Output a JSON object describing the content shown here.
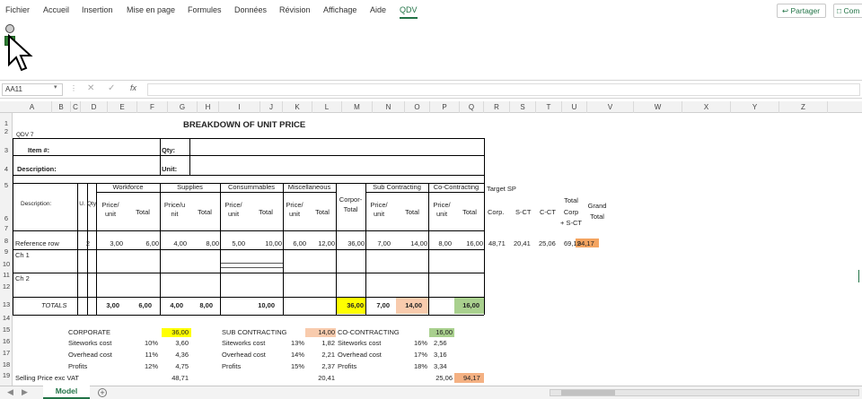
{
  "menu": [
    "Fichier",
    "Accueil",
    "Insertion",
    "Mise en page",
    "Formules",
    "Données",
    "Révision",
    "Affichage",
    "Aide",
    "QDV"
  ],
  "share_label": "Partager",
  "comments_label": "Com",
  "namebox": "AA11",
  "formula_value": "",
  "columns": [
    "A",
    "B",
    "C",
    "D",
    "E",
    "F",
    "G",
    "H",
    "I",
    "J",
    "K",
    "L",
    "M",
    "N",
    "O",
    "P",
    "Q",
    "R",
    "S",
    "T",
    "U",
    "V",
    "W",
    "X",
    "Y",
    "Z"
  ],
  "rows": [
    "1",
    "2",
    "3",
    "4",
    "5",
    "6",
    "7",
    "8",
    "9",
    "10",
    "11",
    "12",
    "13",
    "14",
    "15",
    "16",
    "17",
    "18",
    "19"
  ],
  "sheet": {
    "title": "BREAKDOWN OF UNIT PRICE",
    "qdv": "QDV 7",
    "item_label": "Item #:",
    "qty_label": "Qty:",
    "desc_label": "Description:",
    "unit_label": "Unit:",
    "groups": {
      "workforce": "Workforce",
      "supplies": "Supplies",
      "consumables": "Consummables",
      "misc": "Miscellaneous",
      "sub": "Sub Contracting",
      "co": "Co-Contracting",
      "target": "Target SP"
    },
    "sub": {
      "desc": "Description:",
      "u": "U.",
      "qty": "Qty",
      "price_unit": "Price/ unit",
      "total": "Total",
      "price_u_nit": "Price/u nit",
      "price_slash": "Price/",
      "corpor": "Corpor-",
      "corp_total": "Total",
      "corp": "Corp.",
      "sct": "S-CT",
      "cct": "C-CT",
      "total_corp1": "Total",
      "total_corp2": "Corp",
      "total_corp3": "+ S-CT",
      "grand1": "Grand",
      "grand2": "Total"
    },
    "ref": {
      "label": "Reference row",
      "qty": "2",
      "wf_pu": "3,00",
      "wf_t": "6,00",
      "su_pu": "4,00",
      "su_t": "8,00",
      "cs_pu": "5,00",
      "cs_t": "10,00",
      "mi_pu": "6,00",
      "mi_t": "12,00",
      "corp": "36,00",
      "sc_pu": "7,00",
      "sc_t": "14,00",
      "co_pu": "8,00",
      "co_t": "16,00",
      "t_corp": "48,71",
      "t_sct": "20,41",
      "t_cct": "25,06",
      "t_total": "69,12",
      "grand": "94,17"
    },
    "ch1": "Ch 1",
    "ch2": "Ch 2",
    "totals": {
      "label": "TOTALS",
      "wf_pu": "3,00",
      "wf_t": "6,00",
      "su_pu": "4,00",
      "su_t": "8,00",
      "cs_t": "10,00",
      "corp": "36,00",
      "sc_pu": "7,00",
      "sc_t": "14,00",
      "co_t": "16,00"
    },
    "summary": {
      "corporate": "CORPORATE",
      "corporate_val": "36,00",
      "siteworks": "Siteworks cost",
      "siteworks_pct": "10%",
      "siteworks_val": "3,60",
      "overhead": "Overhead cost",
      "overhead_pct": "11%",
      "overhead_val": "4,36",
      "profits": "Profits",
      "profits_pct": "12%",
      "profits_val": "4,75",
      "selling": "Selling Price  exc VAT",
      "selling_val": "48,71",
      "subc": "SUB CONTRACTING",
      "subc_val": "14,00",
      "sub_site": "Siteworks cost",
      "sub_site_pct": "13%",
      "sub_site_val": "1,82",
      "sub_over": "Overhead cost",
      "sub_over_pct": "14%",
      "sub_over_val": "2,21",
      "sub_prof": "Profits",
      "sub_prof_pct": "15%",
      "sub_prof_val": "2,37",
      "sub_sell_val": "20,41",
      "coc": "CO-CONTRACTING",
      "coc_val": "16,00",
      "co_site": "Siteworks cost",
      "co_site_pct": "16%",
      "co_site_val": "2,56",
      "co_over": "Overhead cost",
      "co_over_pct": "17%",
      "co_over_val": "3,16",
      "co_prof": "Profits",
      "co_prof_pct": "18%",
      "co_prof_val": "3,34",
      "co_sell_val": "25,06",
      "grand_val": "94,17"
    }
  },
  "tab_name": "Model",
  "colors": {
    "yellow": "#ffff00",
    "peach": "#f8cbad",
    "green": "#a9d08e",
    "orange": "#f4b183",
    "deep_orange": "#f4a460",
    "excel_green": "#217346"
  }
}
